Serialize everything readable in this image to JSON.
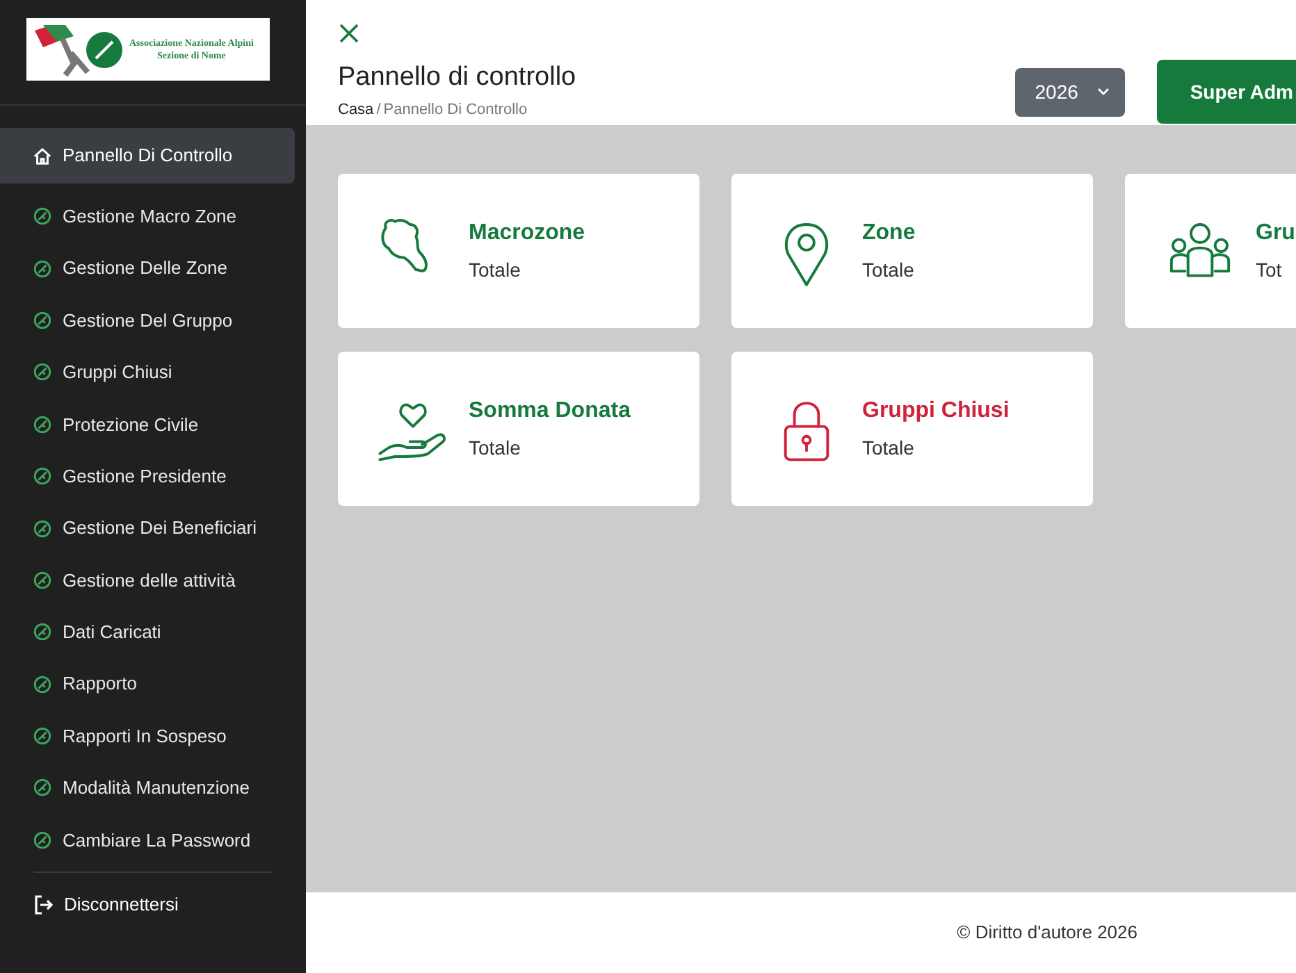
{
  "logo": {
    "line_1": "Associazione Nazionale Alpini",
    "line_2": "Sezione di Nome"
  },
  "sidebar": {
    "items": [
      {
        "label": "Pannello Di Controllo",
        "kind": "home",
        "selected": true
      },
      {
        "label": "Gestione Macro Zone",
        "kind": "module",
        "selected": false
      },
      {
        "label": "Gestione Delle Zone",
        "kind": "module",
        "selected": false
      },
      {
        "label": "Gestione Del Gruppo",
        "kind": "module",
        "selected": false
      },
      {
        "label": "Gruppi Chiusi",
        "kind": "module",
        "selected": false
      },
      {
        "label": "Protezione Civile",
        "kind": "module",
        "selected": false
      },
      {
        "label": "Gestione Presidente",
        "kind": "module",
        "selected": false
      },
      {
        "label": "Gestione Dei Beneficiari",
        "kind": "module",
        "selected": false
      },
      {
        "label": "Gestione delle attività",
        "kind": "module",
        "selected": false
      },
      {
        "label": "Dati Caricati",
        "kind": "module",
        "selected": false
      },
      {
        "label": "Rapporto",
        "kind": "module",
        "selected": false
      },
      {
        "label": "Rapporti In Sospeso",
        "kind": "module",
        "selected": false
      },
      {
        "label": "Modalità Manutenzione",
        "kind": "module",
        "selected": false
      },
      {
        "label": "Cambiare La Password",
        "kind": "module",
        "selected": false
      }
    ],
    "logout": "Disconnettersi"
  },
  "header": {
    "title": "Pannello di controllo",
    "breadcrumb": {
      "items": [
        "Casa",
        "Pannello Di Controllo"
      ],
      "separator": "/"
    },
    "year_select": "2026",
    "user_button": "Super Adm"
  },
  "cards": [
    {
      "kind": "map",
      "title": "Macrozone",
      "subtitle": "Totale",
      "color": "#157a3c"
    },
    {
      "kind": "pin",
      "title": "Zone",
      "subtitle": "Totale",
      "color": "#157a3c"
    },
    {
      "kind": "people",
      "title": "Gru",
      "subtitle": "Tot",
      "color": "#157a3c"
    },
    {
      "kind": "donation",
      "title": "Somma Donata",
      "subtitle": "Totale",
      "color": "#157a3c"
    },
    {
      "kind": "lock",
      "title": "Gruppi Chiusi",
      "subtitle": "Totale",
      "color": "#d0223a"
    }
  ],
  "footer": "© Diritto d'autore 2026"
}
